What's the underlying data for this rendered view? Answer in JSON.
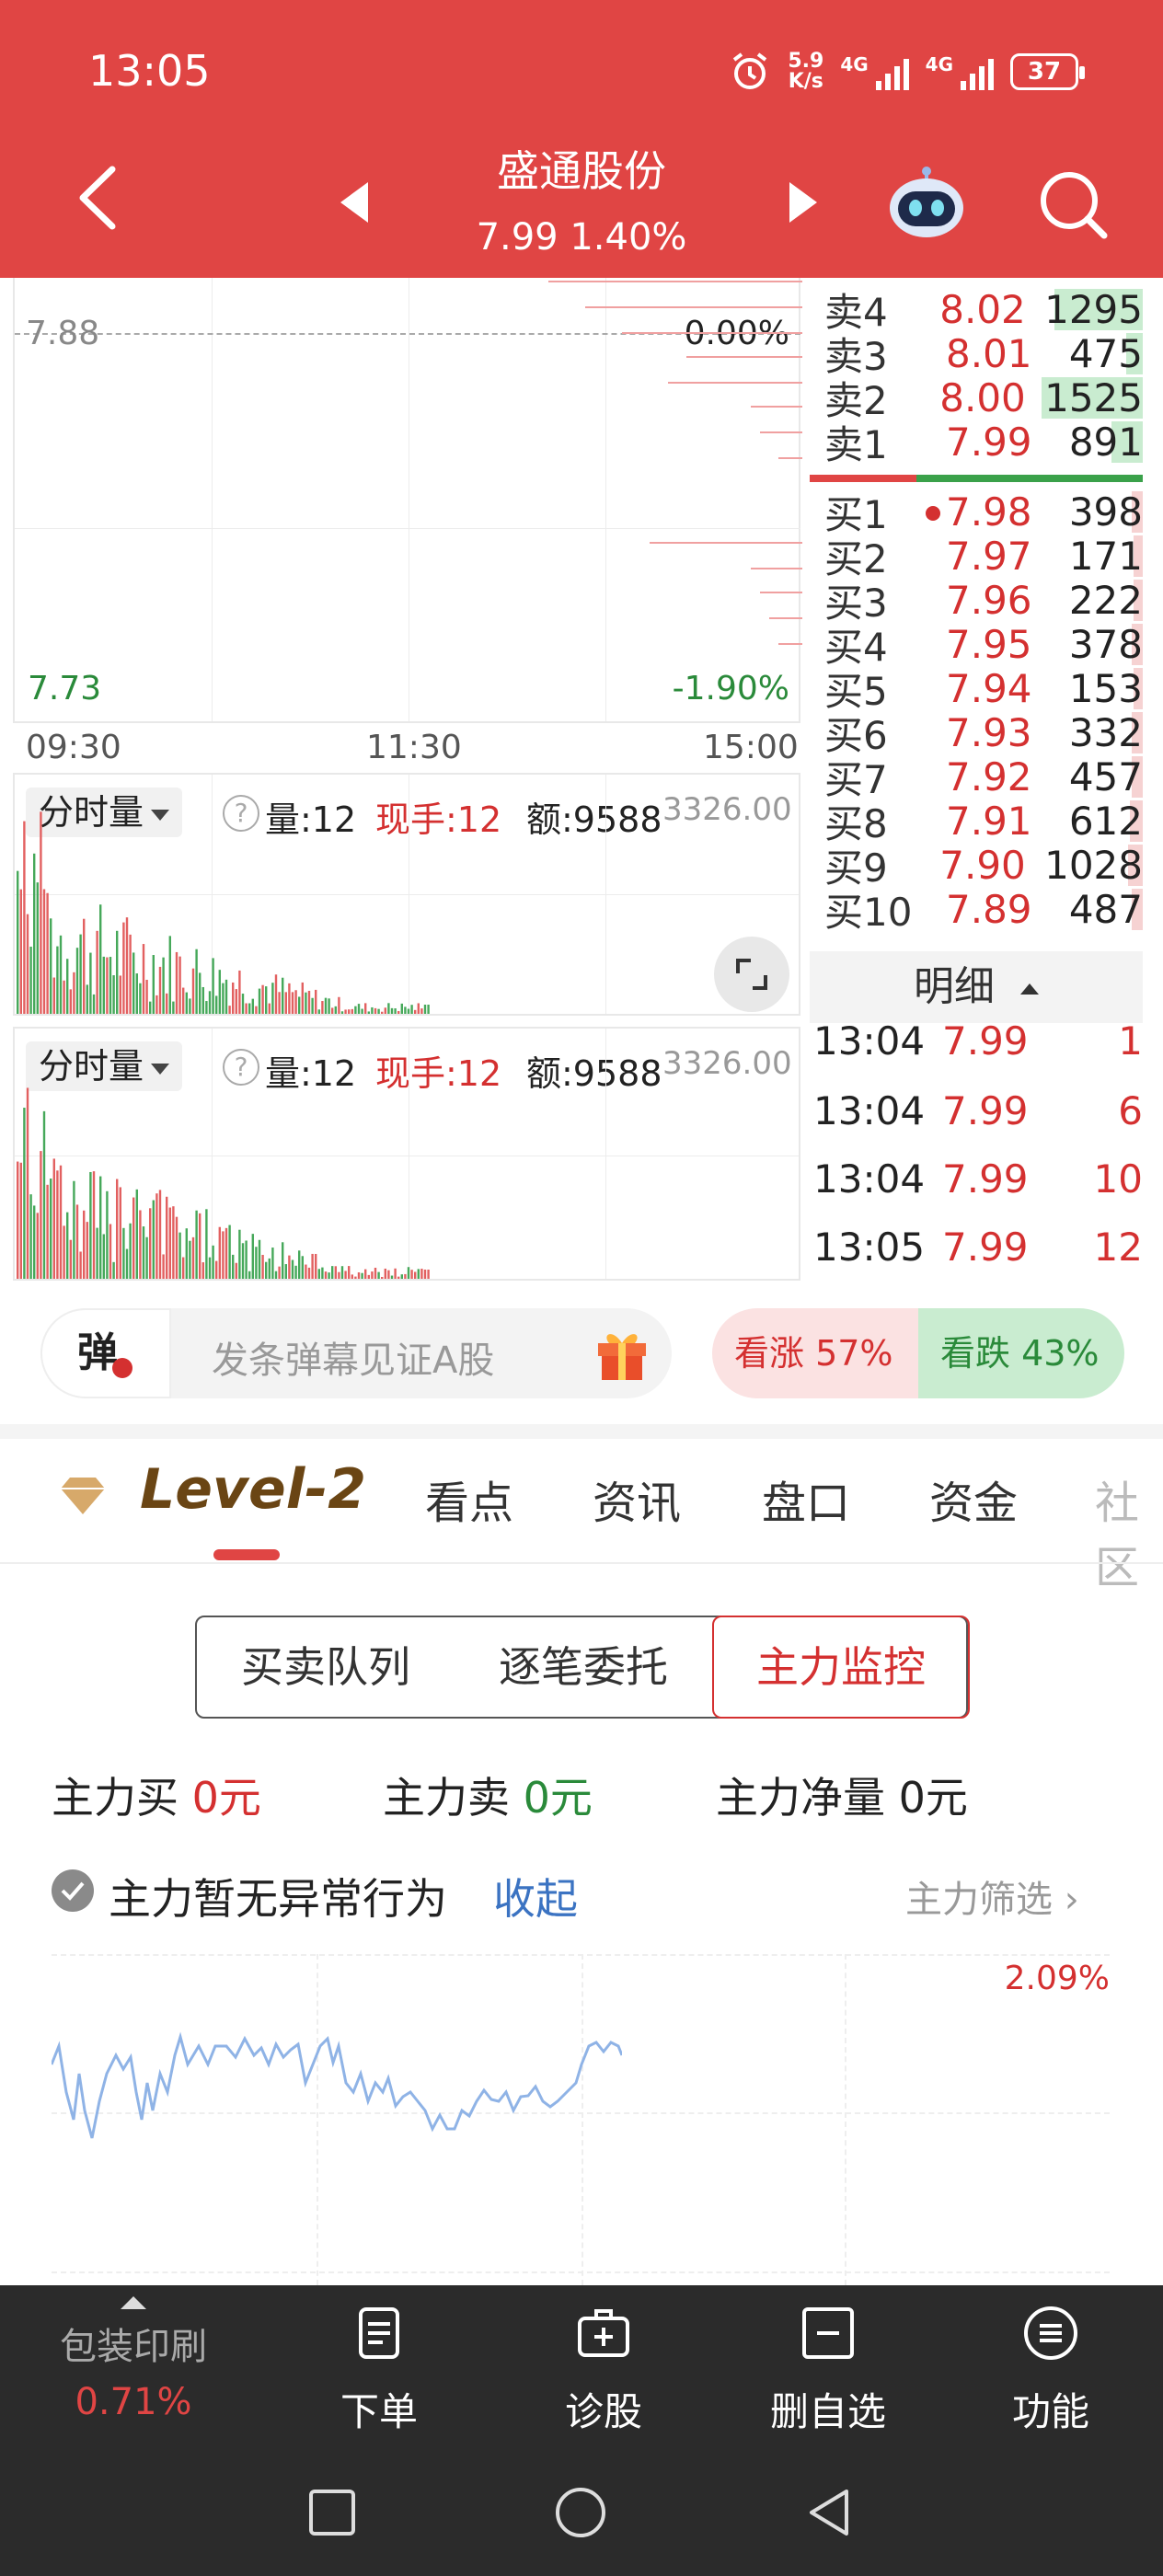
{
  "status_bar": {
    "time": "13:05",
    "net_speed_value": "5.9",
    "net_speed_unit": "K/s",
    "signal_1": "4G",
    "signal_2": "4G",
    "battery": "37"
  },
  "header": {
    "stock_name": "盛通股份",
    "price_change": "7.99 1.40%"
  },
  "timeshare_chart": {
    "ref_price": "7.88",
    "ref_pct": "0.00%",
    "low_price": "7.73",
    "low_pct": "-1.90%",
    "time_labels": [
      "09:30",
      "11:30",
      "15:00"
    ]
  },
  "order_book": {
    "asks": [
      {
        "label": "卖4",
        "price": "8.02",
        "volume": "1295",
        "bar_fraction": 0.85
      },
      {
        "label": "卖3",
        "price": "8.01",
        "volume": "475",
        "bar_fraction": 0.15
      },
      {
        "label": "卖2",
        "price": "8.00",
        "volume": "1525",
        "bar_fraction": 0.95
      },
      {
        "label": "卖1",
        "price": "7.99",
        "volume": "891",
        "bar_fraction": 0.3
      }
    ],
    "bids": [
      {
        "label": "买1",
        "price": "7.98",
        "volume": "398"
      },
      {
        "label": "买2",
        "price": "7.97",
        "volume": "171"
      },
      {
        "label": "买3",
        "price": "7.96",
        "volume": "222"
      },
      {
        "label": "买4",
        "price": "7.95",
        "volume": "378"
      },
      {
        "label": "买5",
        "price": "7.94",
        "volume": "153"
      },
      {
        "label": "买6",
        "price": "7.93",
        "volume": "332"
      },
      {
        "label": "买7",
        "price": "7.92",
        "volume": "457"
      },
      {
        "label": "买8",
        "price": "7.91",
        "volume": "612"
      },
      {
        "label": "买9",
        "price": "7.90",
        "volume": "1028"
      },
      {
        "label": "买10",
        "price": "7.89",
        "volume": "487"
      }
    ]
  },
  "volume_panel": {
    "selector": "分时量",
    "vol_label": "量:12",
    "hand_label": "现手:12",
    "amount_label": "额:9588",
    "max_value": "3326.00"
  },
  "detail": {
    "header": "明细",
    "rows": [
      {
        "time": "13:04",
        "price": "7.99",
        "vol": "1"
      },
      {
        "time": "13:04",
        "price": "7.99",
        "vol": "6"
      },
      {
        "time": "13:04",
        "price": "7.99",
        "vol": "10"
      },
      {
        "time": "13:05",
        "price": "7.99",
        "vol": "12"
      }
    ]
  },
  "danmaku": {
    "icon_text": "弹",
    "placeholder": "发条弹幕见证A股",
    "bull_label": "看涨 57%",
    "bear_label": "看跌 43%"
  },
  "tabs": [
    "Level-2",
    "看点",
    "资讯",
    "盘口",
    "资金",
    "社区"
  ],
  "segments": [
    "买卖队列",
    "逐笔委托",
    "主力监控"
  ],
  "main_force": {
    "buy_label": "主力买",
    "buy_value": "0元",
    "sell_label": "主力卖",
    "sell_value": "0元",
    "net_label": "主力净量",
    "net_value": "0元",
    "status": "主力暂无异常行为",
    "collapse": "收起",
    "filter": "主力筛选",
    "chart_top_pct": "2.09%"
  },
  "bottom_nav": {
    "sector_name": "包装印刷",
    "sector_pct": "0.71%",
    "items": [
      "下单",
      "诊股",
      "删自选",
      "功能"
    ]
  },
  "colors": {
    "brand_red": "#e04544",
    "up_red": "#d43030",
    "down_green": "#2a8a3a",
    "line_blue": "#8fb3e6"
  }
}
